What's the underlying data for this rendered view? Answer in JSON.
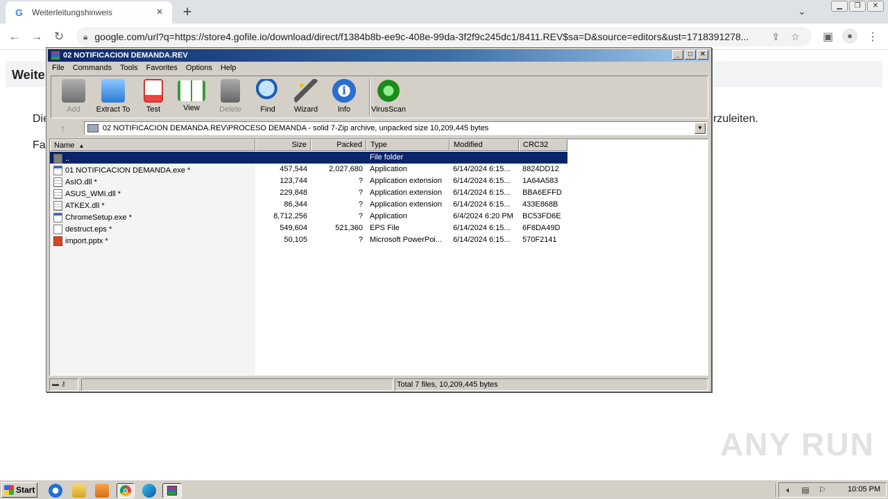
{
  "browser": {
    "tab_title": "Weiterleitungshinweis",
    "url": "google.com/url?q=https://store4.gofile.io/download/direct/f1384b8b-ee9c-408e-99da-3f2f9c245dc1/8411.REV$sa=D&source=editors&ust=1718391278..."
  },
  "page": {
    "heading": "Weite",
    "line1_start": "Die",
    "line1_end": "rzuleiten.",
    "line2_start": "Fa"
  },
  "winrar": {
    "title": "02 NOTIFICACION DEMANDA.REV",
    "menu": [
      "File",
      "Commands",
      "Tools",
      "Favorites",
      "Options",
      "Help"
    ],
    "toolbar": [
      {
        "label": "Add",
        "icon": "add-icon",
        "enabled": false
      },
      {
        "label": "Extract To",
        "icon": "extract-folder-icon",
        "enabled": true
      },
      {
        "label": "Test",
        "icon": "test-clipboard-icon",
        "enabled": true
      },
      {
        "label": "View",
        "icon": "view-book-icon",
        "enabled": true
      },
      {
        "label": "Delete",
        "icon": "trash-icon",
        "enabled": false
      },
      {
        "label": "Find",
        "icon": "magnifier-icon",
        "enabled": true
      },
      {
        "label": "Wizard",
        "icon": "wand-icon",
        "enabled": true
      },
      {
        "label": "Info",
        "icon": "info-icon",
        "enabled": true
      },
      {
        "label": "VirusScan",
        "icon": "bug-icon",
        "enabled": true
      }
    ],
    "path": "02 NOTIFICACION DEMANDA.REV\\PROCESO DEMANDA - solid 7-Zip archive, unpacked size 10,209,445 bytes",
    "columns": [
      "Name",
      "Size",
      "Packed",
      "Type",
      "Modified",
      "CRC32"
    ],
    "rows": [
      {
        "icon": "folder",
        "name": "..",
        "size": "",
        "packed": "",
        "type": "File folder",
        "modified": "",
        "crc": "",
        "selected": true
      },
      {
        "icon": "exe",
        "name": "01 NOTIFICACION DEMANDA.exe *",
        "size": "457,544",
        "packed": "2,027,680",
        "type": "Application",
        "modified": "6/14/2024 6:15...",
        "crc": "8824DD12"
      },
      {
        "icon": "dll",
        "name": "AsIO.dll *",
        "size": "123,744",
        "packed": "?",
        "type": "Application extension",
        "modified": "6/14/2024 6:15...",
        "crc": "1A64A583"
      },
      {
        "icon": "dll",
        "name": "ASUS_WMI.dll *",
        "size": "229,848",
        "packed": "?",
        "type": "Application extension",
        "modified": "6/14/2024 6:15...",
        "crc": "BBA6EFFD"
      },
      {
        "icon": "dll",
        "name": "ATKEX.dll *",
        "size": "86,344",
        "packed": "?",
        "type": "Application extension",
        "modified": "6/14/2024 6:15...",
        "crc": "433E868B"
      },
      {
        "icon": "exe",
        "name": "ChromeSetup.exe *",
        "size": "8,712,256",
        "packed": "?",
        "type": "Application",
        "modified": "6/4/2024 6:20 PM",
        "crc": "BC53FD6E"
      },
      {
        "icon": "file",
        "name": "destruct.eps *",
        "size": "549,604",
        "packed": "521,360",
        "type": "EPS File",
        "modified": "6/14/2024 6:15...",
        "crc": "6F8DA49D"
      },
      {
        "icon": "ppt",
        "name": "import.pptx *",
        "size": "50,105",
        "packed": "?",
        "type": "Microsoft PowerPoi...",
        "modified": "6/14/2024 6:15...",
        "crc": "570F2141"
      }
    ],
    "status_total": "Total 7 files, 10,209,445 bytes"
  },
  "watermark": "ANY RUN",
  "taskbar": {
    "start_label": "Start",
    "clock": "10:05 PM"
  }
}
